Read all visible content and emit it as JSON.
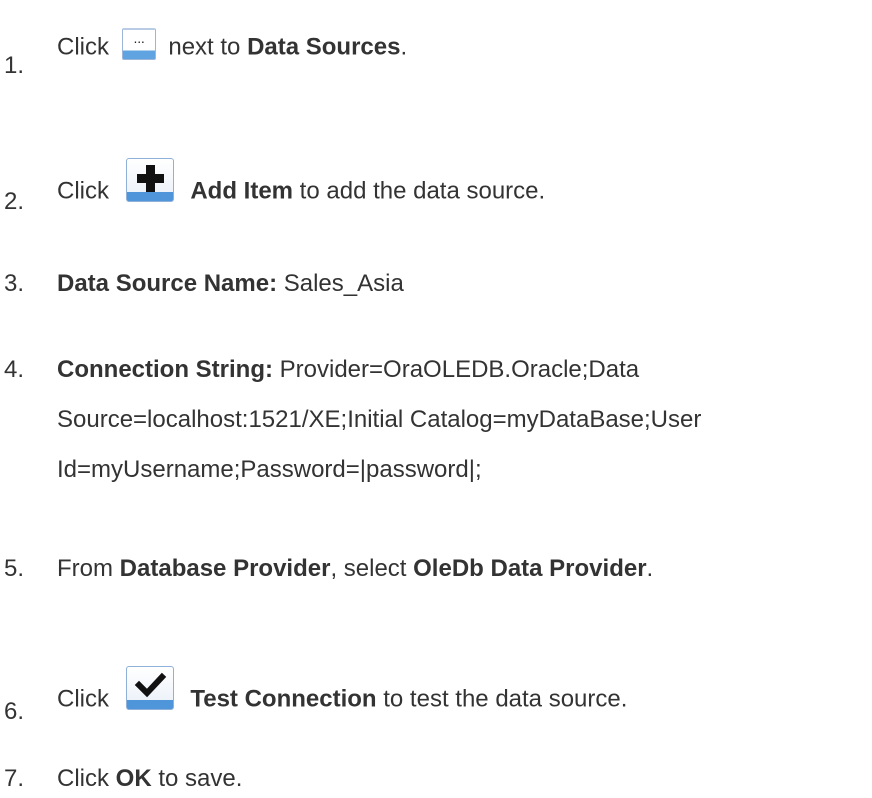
{
  "steps": [
    {
      "number": "1.",
      "prefix": "Click",
      "icon": "ellipsis-icon",
      "rest_before": "next to ",
      "bold": "Data Sources",
      "rest_after": "."
    },
    {
      "number": "2.",
      "prefix": "Click",
      "icon": "plus-icon",
      "bold": "Add Item",
      "rest_after": " to add the data source."
    },
    {
      "number": "3.",
      "bold": "Data Source Name:",
      "rest_after": " Sales_Asia"
    },
    {
      "number": "4.",
      "bold": "Connection String:",
      "lines": [
        "Provider=OraOLEDB.Oracle;Data",
        "Source=localhost:1521/XE;Initial Catalog=myDataBase;User",
        "Id=myUsername;Password=|password|;"
      ]
    },
    {
      "number": "5.",
      "prefix": "From ",
      "bold": "Database Provider",
      "middle": ", select ",
      "bold2": "OleDb Data Provider",
      "rest_after": "."
    },
    {
      "number": "6.",
      "prefix": "Click",
      "icon": "checkmark-icon",
      "bold": "Test Connection",
      "rest_after": " to test the data source."
    },
    {
      "number": "7.",
      "prefix": "Click ",
      "bold": "OK",
      "rest_after": " to save."
    }
  ],
  "colors": {
    "text": "#333333",
    "icon_border": "#8fb0d8",
    "icon_accent": "#4f95da"
  }
}
